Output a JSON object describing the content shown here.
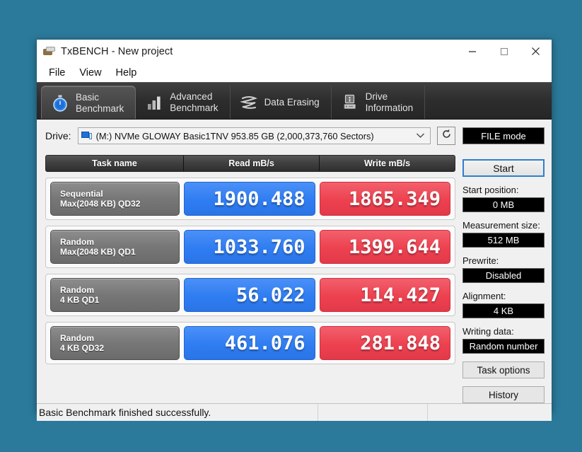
{
  "window": {
    "title": "TxBENCH - New project",
    "app_icon": "txbench-logo-icon",
    "controls": {
      "minimize": "minimize-icon",
      "maximize": "maximize-icon",
      "close": "close-icon"
    }
  },
  "menu": {
    "items": [
      {
        "label": "File"
      },
      {
        "label": "View"
      },
      {
        "label": "Help"
      }
    ]
  },
  "tabs": [
    {
      "line1": "Basic",
      "line2": "Benchmark",
      "icon": "stopwatch-icon",
      "active": true
    },
    {
      "line1": "Advanced",
      "line2": "Benchmark",
      "icon": "bar-chart-icon",
      "active": false
    },
    {
      "line1": "Data Erasing",
      "line2": "",
      "icon": "shredder-icon",
      "active": false
    },
    {
      "line1": "Drive",
      "line2": "Information",
      "icon": "drive-info-icon",
      "active": false
    }
  ],
  "drive": {
    "label": "Drive:",
    "selected": "(M:) NVMe GLOWAY Basic1TNV  953.85 GB (2,000,373,760 Sectors)",
    "disk_icon": "disk-drive-icon",
    "dropdown_icon": "chevron-down-icon",
    "refresh_icon": "refresh-icon"
  },
  "results": {
    "headers": [
      "Task name",
      "Read mB/s",
      "Write mB/s"
    ],
    "rows": [
      {
        "task_line1": "Sequential",
        "task_line2": "Max(2048 KB) QD32",
        "read": "1900.488",
        "write": "1865.349"
      },
      {
        "task_line1": "Random",
        "task_line2": "Max(2048 KB) QD1",
        "read": "1033.760",
        "write": "1399.644"
      },
      {
        "task_line1": "Random",
        "task_line2": "4 KB QD1",
        "read": "56.022",
        "write": "114.427"
      },
      {
        "task_line1": "Random",
        "task_line2": "4 KB QD32",
        "read": "461.076",
        "write": "281.848"
      }
    ]
  },
  "panel": {
    "mode": "FILE mode",
    "start": "Start",
    "start_position_label": "Start position:",
    "start_position_value": "0 MB",
    "measurement_size_label": "Measurement size:",
    "measurement_size_value": "512 MB",
    "prewrite_label": "Prewrite:",
    "prewrite_value": "Disabled",
    "alignment_label": "Alignment:",
    "alignment_value": "4 KB",
    "writing_data_label": "Writing data:",
    "writing_data_value": "Random number",
    "task_options": "Task options",
    "history": "History"
  },
  "status": {
    "message": "Basic Benchmark finished successfully."
  },
  "colors": {
    "desktop": "#2b7a9b",
    "read_accent": "#2f7df2",
    "write_accent": "#ed414f",
    "focus_blue": "#2f7fd0"
  }
}
